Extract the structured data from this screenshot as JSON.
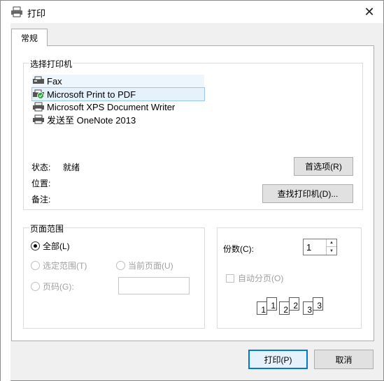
{
  "window": {
    "title": "打印",
    "close_symbol": "✕"
  },
  "tabs": [
    {
      "label": "常规",
      "active": true
    }
  ],
  "printer_group": {
    "legend": "选择打印机",
    "printers": [
      {
        "name": "Fax",
        "icon": "fax-icon",
        "state": "hover"
      },
      {
        "name": "Microsoft Print to PDF",
        "icon": "default-printer-icon",
        "state": "selected"
      },
      {
        "name": "Microsoft XPS Document Writer",
        "icon": "printer-icon",
        "state": "normal"
      },
      {
        "name": "发送至 OneNote 2013",
        "icon": "printer-icon",
        "state": "normal"
      }
    ],
    "status_label": "状态:",
    "status_value": "就绪",
    "location_label": "位置:",
    "comment_label": "备注:",
    "preferences_button": "首选项(R)",
    "find_printer_button": "查找打印机(D)..."
  },
  "page_range": {
    "legend": "页面范围",
    "all": "全部(L)",
    "selection": "选定范围(T)",
    "current_page": "当前页面(U)",
    "pages": "页码(G):",
    "selected": "all"
  },
  "copies": {
    "label": "份数(C):",
    "value": "1",
    "collate_label": "自动分页(O)",
    "collate_checked": false,
    "collate_pages": [
      "1",
      "1",
      "2",
      "2",
      "3",
      "3"
    ]
  },
  "footer": {
    "print_button": "打印(P)",
    "cancel_button": "取消"
  },
  "colors": {
    "accent": "#0078d7",
    "selected_row": "#e5f1fb",
    "disabled_text": "#a0a0a0"
  }
}
